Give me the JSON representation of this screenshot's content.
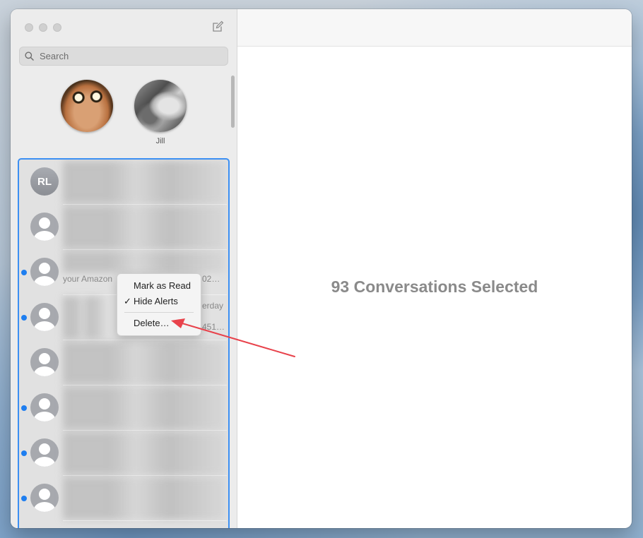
{
  "search": {
    "placeholder": "Search"
  },
  "pinned": [
    {
      "name": "",
      "avatar": "jar-jar-photo"
    },
    {
      "name": "Jill",
      "avatar": "jill-photo"
    }
  ],
  "conversations": [
    {
      "initials": "RL",
      "unread": false,
      "snippet": "",
      "time": ""
    },
    {
      "initials": "",
      "unread": false,
      "snippet": "",
      "time": ""
    },
    {
      "initials": "",
      "unread": true,
      "snippet": "your Amazon",
      "time": "02…"
    },
    {
      "initials": "",
      "unread": true,
      "snippet": "451…",
      "time": "erday"
    },
    {
      "initials": "",
      "unread": false,
      "snippet": "",
      "time": ""
    },
    {
      "initials": "",
      "unread": true,
      "snippet": "",
      "time": ""
    },
    {
      "initials": "",
      "unread": true,
      "snippet": "",
      "time": ""
    },
    {
      "initials": "",
      "unread": true,
      "snippet": "",
      "time": ""
    }
  ],
  "context_menu": {
    "items": [
      {
        "label": "Mark as Read",
        "checked": false
      },
      {
        "label": "Hide Alerts",
        "checked": true
      },
      {
        "label": "Delete…",
        "checked": false
      }
    ],
    "check_glyph": "✓"
  },
  "detail": {
    "headline": "93 Conversations Selected"
  },
  "colors": {
    "selection": "#3b8ff3",
    "unread_dot": "#1e7ef0",
    "annotation_arrow": "#e8424b"
  },
  "icons": [
    "compose-icon",
    "search-icon",
    "person-placeholder-icon"
  ]
}
